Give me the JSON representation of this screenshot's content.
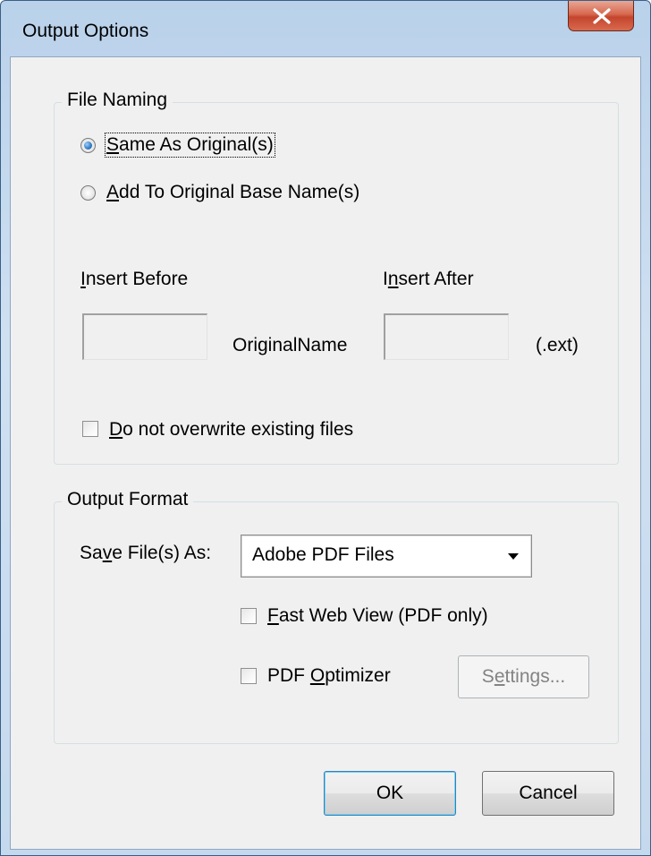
{
  "window": {
    "title": "Output Options",
    "close_glyph": "X"
  },
  "file_naming": {
    "title": "File Naming",
    "radio_same": {
      "mnemonic": "S",
      "rest": "ame As Original(s)",
      "selected": true
    },
    "radio_add": {
      "mnemonic": "A",
      "rest": "dd To Original Base Name(s)",
      "selected": false
    },
    "insert_before": {
      "mnemonic": "I",
      "rest": "nsert Before",
      "value": ""
    },
    "insert_after": {
      "pre": "I",
      "mnemonic": "n",
      "rest": "sert After",
      "value": ""
    },
    "original_name": "OriginalName",
    "ext": "(.ext)",
    "no_overwrite": {
      "mnemonic": "D",
      "rest": "o not overwrite existing files",
      "checked": false
    }
  },
  "output_format": {
    "title": "Output Format",
    "save_as_label": {
      "pre": "Sa",
      "mnemonic": "v",
      "rest": "e File(s) As:"
    },
    "save_as_value": "Adobe PDF Files",
    "fast_web_view": {
      "mnemonic": "F",
      "rest": "ast Web View (PDF only)",
      "checked": false
    },
    "pdf_optimizer": {
      "pre": "PDF ",
      "mnemonic": "O",
      "rest": "ptimizer",
      "checked": false
    },
    "settings_button": {
      "pre": "S",
      "mnemonic": "e",
      "rest": "ttings...",
      "enabled": false
    }
  },
  "buttons": {
    "ok": "OK",
    "cancel": "Cancel"
  },
  "colors": {
    "title_bar": "#b9d1ea",
    "close_button": "#c4452d",
    "dialog_face": "#f0f0f0",
    "radio_selected": "#2f78c6"
  }
}
